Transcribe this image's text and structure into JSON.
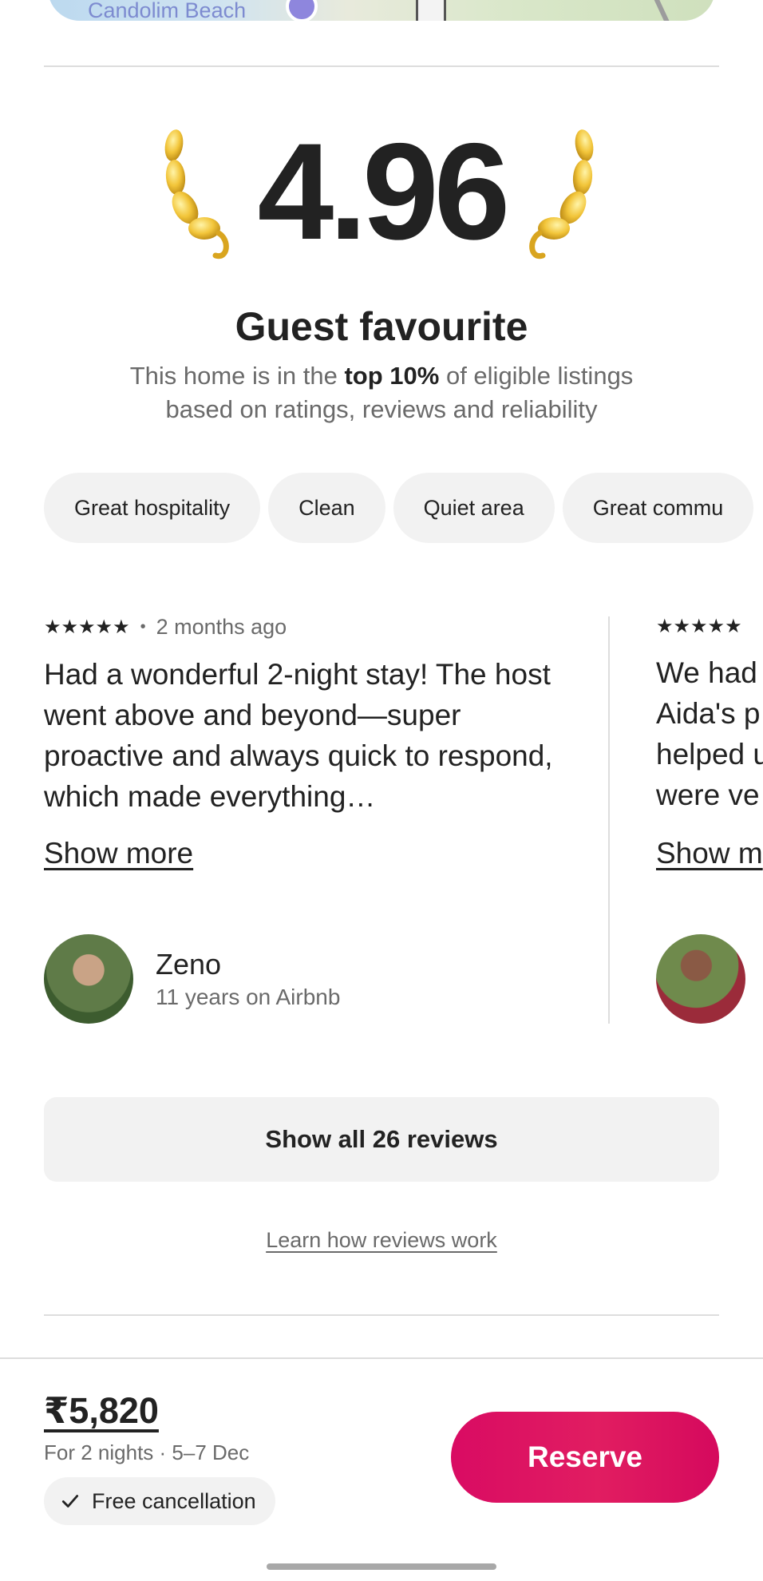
{
  "map": {
    "label": "Candolim Beach"
  },
  "rating": {
    "value": "4.96"
  },
  "guest_favourite": {
    "title": "Guest favourite",
    "desc_prefix": "This home is in the ",
    "desc_bold": "top 10%",
    "desc_suffix": " of eligible listings based on ratings, reviews and reliability"
  },
  "chips": [
    "Great hospitality",
    "Clean",
    "Quiet area",
    "Great commu"
  ],
  "reviews": [
    {
      "stars": "★★★★★",
      "ago": "2 months ago",
      "text": "Had a wonderful 2-night stay! The host went above and beyond—super proactive and always quick to respond, which made everything…",
      "show_more": "Show more",
      "name": "Zeno",
      "meta": "11 years on Airbnb"
    },
    {
      "stars": "★★★★★",
      "text_lines": [
        "We had",
        "Aida's p",
        "helped u",
        "were ve"
      ],
      "show_more": "Show m"
    }
  ],
  "show_all_reviews": "Show all 26 reviews",
  "learn_link": "Learn how reviews work",
  "bottom_bar": {
    "price": "₹5,820",
    "price_sub": "For 2 nights · 5–7 Dec",
    "free_cancellation": "Free cancellation",
    "reserve": "Reserve"
  },
  "colors": {
    "accent": "#e11d61",
    "text": "#222222",
    "muted": "#6a6a6a",
    "chip_bg": "#f2f2f2"
  }
}
